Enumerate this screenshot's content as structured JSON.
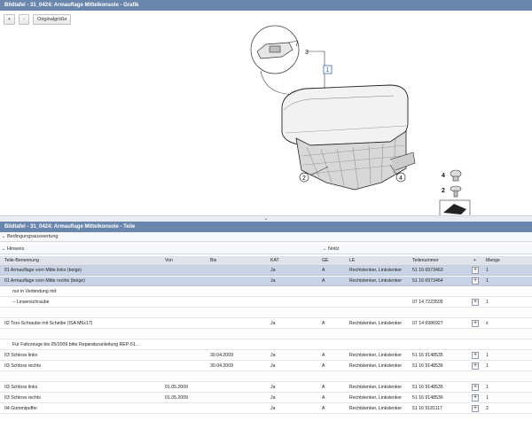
{
  "graphic_panel": {
    "title": "Bildtafel - 31_0424: Armauflage Mittelkonsole - Grafik",
    "zoom_in_label": "+",
    "zoom_out_label": "-",
    "original_size_label": "Originalgröße",
    "callouts": [
      "3",
      "1",
      "2",
      "4",
      "4",
      "2"
    ]
  },
  "splitter_label": "⌄",
  "parts_panel": {
    "title": "Bildtafel - 31_0424: Armauflage Mittelkonsole - Teile",
    "conditions_label": "Bedingungsauswertung",
    "hint_label": "Hinweis",
    "note_label": "Notiz",
    "columns": {
      "name": "Teile-Benennung",
      "von": "Von",
      "bis": "Bis",
      "kat": "KAT",
      "ge": "GE",
      "le": "LE",
      "nr": "Teilenummer",
      "plus": "+",
      "menge": "Menge"
    },
    "rows": [
      {
        "name": "01 Armauflage vorn Mitte links (beige)",
        "von": "",
        "bis": "",
        "kat": "Ja",
        "ge": "A",
        "le": "Rechtslenker, Linkslenker",
        "nr": "51 16 6973463",
        "plus": "+",
        "menge": "1"
      },
      {
        "name": "01 Armauflage vorn Mitte rechts (beige)",
        "von": "",
        "bis": "",
        "kat": "Ja",
        "ge": "A",
        "le": "Rechtslenker, Linkslenker",
        "nr": "51 16 6973464",
        "plus": "+",
        "menge": "1"
      },
      {
        "name": "nur in Verbindung mit:",
        "von": "",
        "bis": "",
        "kat": "",
        "ge": "",
        "le": "",
        "nr": "",
        "plus": "",
        "menge": ""
      },
      {
        "name": "-- Linsenschraube",
        "von": "",
        "bis": "",
        "kat": "",
        "ge": "",
        "le": "",
        "nr": "07 14 7223505",
        "plus": "+",
        "menge": "1"
      },
      {
        "name": "",
        "von": "",
        "bis": "",
        "kat": "",
        "ge": "",
        "le": "",
        "nr": "",
        "plus": "",
        "menge": ""
      },
      {
        "name": "02 Torx-Schraube mit Scheibe (ISA M6x17)",
        "von": "",
        "bis": "",
        "kat": "Ja",
        "ge": "A",
        "le": "Rechtslenker, Linkslenker",
        "nr": "07 14 6986927",
        "plus": "+",
        "menge": "x"
      },
      {
        "name": "",
        "von": "",
        "bis": "",
        "kat": "",
        "ge": "",
        "le": "",
        "nr": "",
        "plus": "",
        "menge": ""
      },
      {
        "name": "Für Fahrzeuge bis 05/2009 bitte Reparaturanleitung REP-51...",
        "von": "",
        "bis": "",
        "kat": "",
        "ge": "",
        "le": "",
        "nr": "",
        "plus": "",
        "menge": ""
      },
      {
        "name": "03 Schloss links",
        "von": "",
        "bis": "30.04.2009",
        "kat": "Ja",
        "ge": "A",
        "le": "Rechtslenker, Linkslenker",
        "nr": "51 16 9148535",
        "plus": "+",
        "menge": "1"
      },
      {
        "name": "03 Schloss rechts",
        "von": "",
        "bis": "30.04.2009",
        "kat": "Ja",
        "ge": "A",
        "le": "Rechtslenker, Linkslenker",
        "nr": "51 16 9148536",
        "plus": "+",
        "menge": "1"
      },
      {
        "name": "",
        "von": "",
        "bis": "",
        "kat": "",
        "ge": "",
        "le": "",
        "nr": "",
        "plus": "",
        "menge": ""
      },
      {
        "name": "03 Schloss links",
        "von": "01.05.2009",
        "bis": "",
        "kat": "Ja",
        "ge": "A",
        "le": "Rechtslenker, Linkslenker",
        "nr": "51 16 9148535",
        "plus": "+",
        "menge": "1"
      },
      {
        "name": "03 Schloss rechts",
        "von": "01.05.2009",
        "bis": "",
        "kat": "Ja",
        "ge": "A",
        "le": "Rechtslenker, Linkslenker",
        "nr": "51 16 9148536",
        "plus": "+",
        "menge": "1"
      },
      {
        "name": "04 Gummipuffer",
        "von": "",
        "bis": "",
        "kat": "Ja",
        "ge": "A",
        "le": "Rechtslenker, Linkslenker",
        "nr": "51 16 9181117",
        "plus": "+",
        "menge": "2"
      }
    ]
  }
}
